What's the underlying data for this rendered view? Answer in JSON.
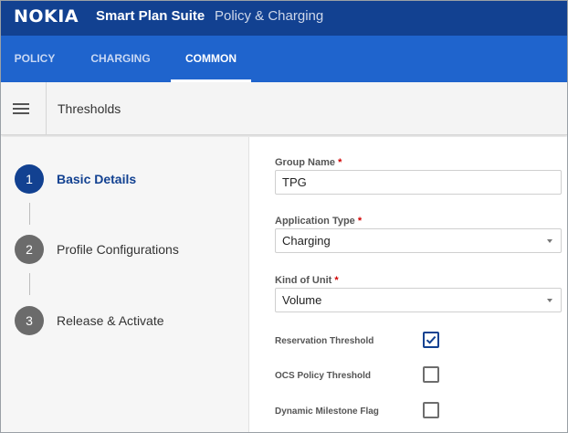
{
  "brand": {
    "logo": "NOKIA",
    "suite": "Smart Plan Suite",
    "product": "Policy & Charging"
  },
  "tabs": [
    {
      "label": "POLICY",
      "active": false
    },
    {
      "label": "CHARGING",
      "active": false
    },
    {
      "label": "COMMON",
      "active": true
    }
  ],
  "toolbar": {
    "menu_icon": "hamburger-menu-icon",
    "title": "Thresholds"
  },
  "steps": [
    {
      "number": "1",
      "label": "Basic Details",
      "active": true
    },
    {
      "number": "2",
      "label": "Profile Configurations",
      "active": false
    },
    {
      "number": "3",
      "label": "Release & Activate",
      "active": false
    }
  ],
  "form": {
    "group_name": {
      "label": "Group Name",
      "required_mark": "*",
      "value": "TPG"
    },
    "application_type": {
      "label": "Application Type",
      "required_mark": "*",
      "value": "Charging"
    },
    "kind_of_unit": {
      "label": "Kind of Unit",
      "required_mark": "*",
      "value": "Volume"
    },
    "checkboxes": [
      {
        "label": "Reservation Threshold",
        "checked": true
      },
      {
        "label": "OCS Policy Threshold",
        "checked": false
      },
      {
        "label": "Dynamic Milestone Flag",
        "checked": false
      }
    ]
  },
  "colors": {
    "brand_dark": "#124191",
    "tab_bar": "#1f64cd",
    "required": "#d10000"
  }
}
